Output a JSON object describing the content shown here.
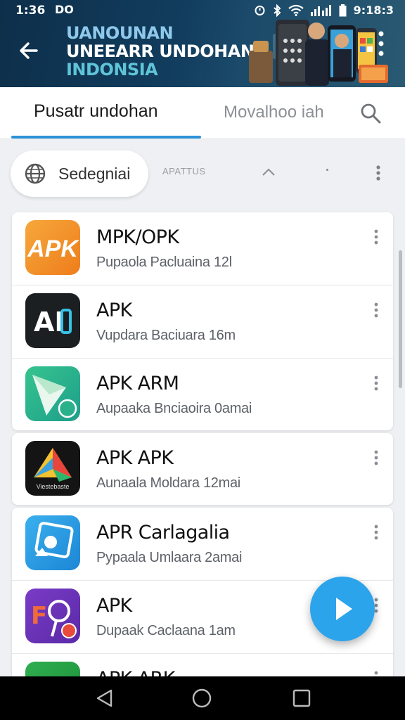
{
  "status_bar": {
    "time": "1:36",
    "notification": "DO",
    "clock": "9:18:3",
    "icons": [
      "alarm-icon",
      "bluetooth-icon",
      "wifi-icon",
      "signal-icon",
      "battery-icon"
    ]
  },
  "banner": {
    "title_line1": "UANOUNAN",
    "title_line2": "UNEEARR UNDOHAN",
    "title_line3": "INDONSIA"
  },
  "tabs": {
    "active_label": "Pusatr undohan",
    "inactive_label": "Movalhoo iah"
  },
  "filter": {
    "chip_label": "Sedegniai",
    "sort_label": "APATTUS"
  },
  "apps": [
    {
      "name": "MPK/OPK",
      "subtitle": "Pupaola Pacluaina 12l",
      "icon": "apk-orange-icon"
    },
    {
      "name": "APK",
      "subtitle": "Vupdara Baciuara 16m",
      "icon": "ai-dark-icon"
    },
    {
      "name": "APK ARM",
      "subtitle": "Aupaaka Bnciaoira 0amai",
      "icon": "green-paper-icon"
    },
    {
      "name": "APK APK",
      "subtitle": "Aunaala Moldara 12mai",
      "icon": "triangle-logo-icon"
    },
    {
      "name": "APR Carlagalia",
      "subtitle": "Pypaala Umlaara 2amai",
      "icon": "photo-frame-icon"
    },
    {
      "name": "APK",
      "subtitle": "Dupaak Caclaana 1am",
      "icon": "purple-f-icon"
    },
    {
      "name": "APK ARK",
      "subtitle": "",
      "icon": "green-partial-icon"
    }
  ],
  "icon_texts": {
    "ai_logo": "AI",
    "apk_logo": "APK",
    "f_logo": "F",
    "triangle_logo": "Viestebaste"
  },
  "colors": {
    "accent": "#2c92d8",
    "fab": "#2ba4ec",
    "banner_bg": "#123d5e"
  }
}
